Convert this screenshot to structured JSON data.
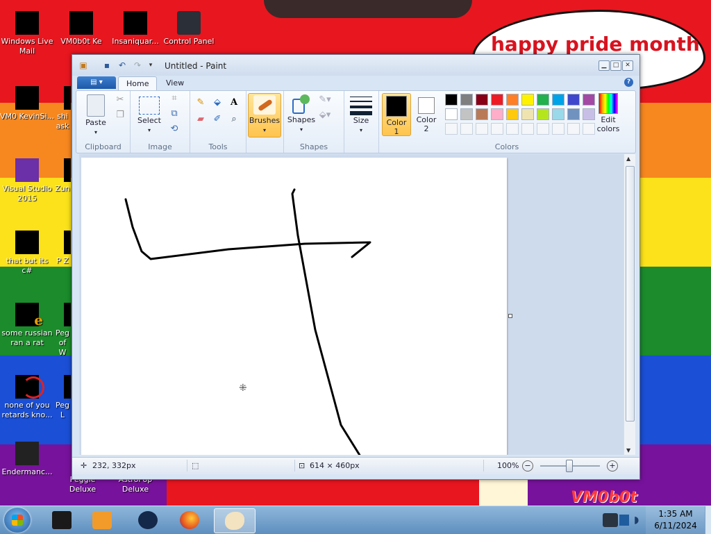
{
  "desktop": {
    "cloud_text": "happy pride month",
    "watermark": "VM0b0t",
    "icons": [
      {
        "label": "Windows Live Mail"
      },
      {
        "label": "VM0b0t Ke"
      },
      {
        "label": "Insaniquar..."
      },
      {
        "label": "Control Panel"
      },
      {
        "label": "VM0 KevinSi..."
      },
      {
        "label": "shi ask"
      },
      {
        "label": "Visual Studio 2015"
      },
      {
        "label": "Zun"
      },
      {
        "label": "that but its c#"
      },
      {
        "label": "P Z"
      },
      {
        "label": "some russian ran a rat"
      },
      {
        "label": "Peg of W"
      },
      {
        "label": "none of you retards kno..."
      },
      {
        "label": "Peg L"
      },
      {
        "label": "Endermanc..."
      },
      {
        "label": "Peggle Deluxe"
      },
      {
        "label": "AstroPop Deluxe"
      }
    ]
  },
  "window": {
    "title": "Untitled - Paint",
    "tabs": [
      {
        "label": "Home"
      },
      {
        "label": "View"
      }
    ],
    "ribbon": {
      "clipboard": {
        "label": "Clipboard",
        "paste": "Paste"
      },
      "image": {
        "label": "Image",
        "select": "Select"
      },
      "tools": {
        "label": "Tools"
      },
      "brushes": "Brushes",
      "shapes": {
        "label": "Shapes",
        "button": "Shapes"
      },
      "size": "Size",
      "colors": {
        "label": "Colors",
        "color1": "Color",
        "color1_num": "1",
        "color2": "Color",
        "color2_num": "2",
        "edit": "Edit",
        "edit2": "colors",
        "palette_row1": [
          "#000000",
          "#7f7f7f",
          "#880015",
          "#ed1c24",
          "#ff7f27",
          "#fff200",
          "#22b14c",
          "#00a2e8",
          "#3f48cc",
          "#a349a4"
        ],
        "palette_row2": [
          "#ffffff",
          "#c3c3c3",
          "#b97a57",
          "#ffaec9",
          "#ffc90e",
          "#efe4b0",
          "#b5e61d",
          "#99d9ea",
          "#7092be",
          "#c8bfe7"
        ]
      }
    },
    "status": {
      "cursor_pos": "232, 332px",
      "canvas_size": "614 × 460px",
      "zoom": "100%"
    }
  },
  "taskbar": {
    "time": "1:35 AM",
    "date": "6/11/2024"
  }
}
